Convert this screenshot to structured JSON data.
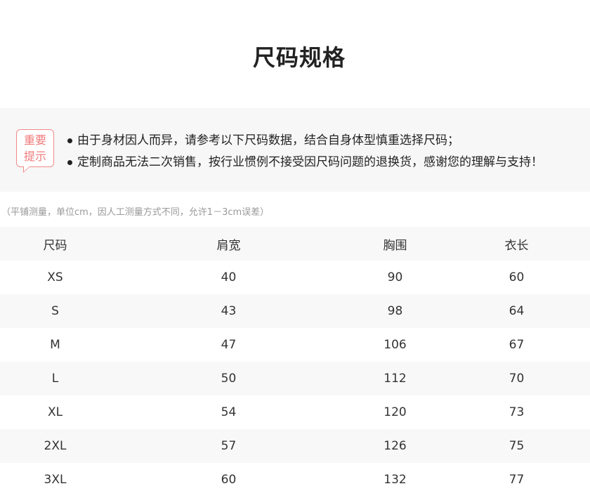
{
  "title": "尺码规格",
  "notice": {
    "badge_line1": "重要",
    "badge_line2": "提示",
    "items": [
      "由于身材因人而异，请参考以下尺码数据，结合自身体型慎重选择尺码；",
      "定制商品无法二次销售，按行业惯例不接受因尺码问题的退换货，感谢您的理解与支持！"
    ]
  },
  "measure_note": "（平铺测量，单位cm，因人工测量方式不同，允许1－3cm误差）",
  "table": {
    "headers": [
      "尺码",
      "肩宽",
      "胸围",
      "衣长"
    ],
    "rows": [
      [
        "XS",
        "40",
        "90",
        "60"
      ],
      [
        "S",
        "43",
        "98",
        "64"
      ],
      [
        "M",
        "47",
        "106",
        "67"
      ],
      [
        "L",
        "50",
        "112",
        "70"
      ],
      [
        "XL",
        "54",
        "120",
        "73"
      ],
      [
        "2XL",
        "57",
        "126",
        "75"
      ],
      [
        "3XL",
        "60",
        "132",
        "77"
      ]
    ]
  },
  "colors": {
    "accent": "#f07a7a",
    "panel_bg": "#f7f7f7",
    "stripe_bg": "#f8f8f8"
  }
}
